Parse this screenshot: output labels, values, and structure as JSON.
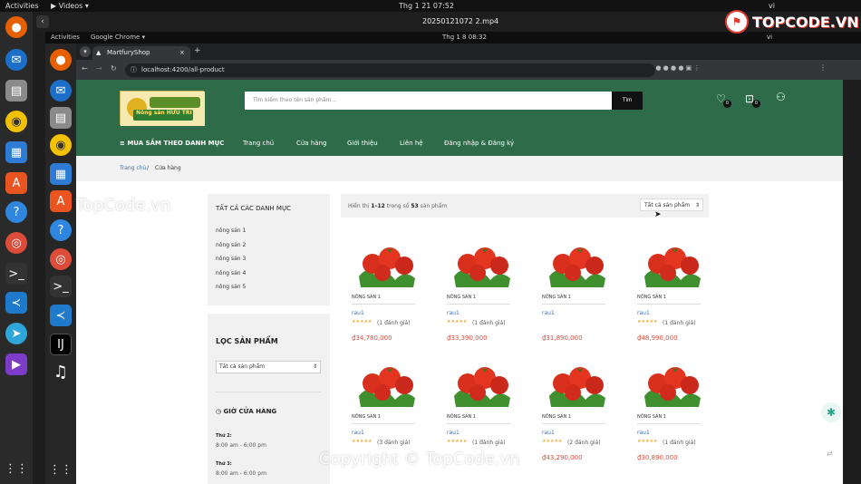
{
  "outer": {
    "activities": "Activities",
    "app_name": "Videos",
    "clock": "Thg 1 21  07:52",
    "lang": "vi",
    "window_title": "20250121072 2.mp4"
  },
  "inner": {
    "activities": "Activities",
    "app_name": "Google Chrome",
    "clock": "Thg 1 8  08:32",
    "lang": "vi"
  },
  "browser": {
    "tab_title": "MartfuryShop",
    "url": "localhost:4200/all-product"
  },
  "watermark": {
    "logo_text": "TOPCODE.VN",
    "left_text": "TopCode.vn",
    "bottom_text": "Copyright © TopCode.vn"
  },
  "shop": {
    "logo_text": "Nông sản HỮU TRÍ",
    "search_placeholder": "Tìm kiếm theo tên sản phẩm...",
    "search_button": "Tìm",
    "wishlist_count": "0",
    "cart_count": "0",
    "menu": {
      "categories": "MUA SẮM THEO DANH MỤC",
      "home": "Trang chủ",
      "store": "Cửa hàng",
      "about": "Giới thiệu",
      "contact": "Liên hệ",
      "auth": "Đăng nhập & Đăng ký"
    },
    "breadcrumb": {
      "home": "Trang chủ",
      "sep": " / ",
      "current": "Cửa hàng"
    },
    "sidebar": {
      "cat_title": "TẤT CẢ CÁC DANH MỤC",
      "categories": [
        "nông sản 1",
        "nông sản 2",
        "nông sản 3",
        "nông sản 4",
        "nông sản 5"
      ],
      "filter_title": "LỌC SẢN PHẨM",
      "filter_select": "Tất cả sản phẩm",
      "hours_title": "GIỜ CỬA HÀNG",
      "hours": [
        {
          "day": "Thứ 2:",
          "time": "8:00 am - 6:00 pm"
        },
        {
          "day": "Thứ 3:",
          "time": "8:00 am - 6:00 pm"
        }
      ]
    },
    "listing": {
      "showing_prefix": "Hiển thị ",
      "showing_range": "1–12",
      "showing_middle": " trong số ",
      "total": "53",
      "showing_suffix": " sản phẩm",
      "sort_label": "Tất cả sản phẩm"
    },
    "products": [
      {
        "category": "NÔNG SẢN 1",
        "name": "rau1",
        "rating": 5,
        "reviews": "(1 đánh giá)",
        "price": "₫34,780,000"
      },
      {
        "category": "NÔNG SẢN 1",
        "name": "rau1",
        "rating": 5,
        "reviews": "(1 đánh giá)",
        "price": "₫33,390,000"
      },
      {
        "category": "NÔNG SẢN 1",
        "name": "rau1",
        "rating": 0,
        "reviews": "",
        "price": "₫31,890,000"
      },
      {
        "category": "NÔNG SẢN 1",
        "name": "rau1",
        "rating": 5,
        "reviews": "(1 đánh giá)",
        "price": "₫48,990,000"
      },
      {
        "category": "NÔNG SẢN 1",
        "name": "rau1",
        "rating": 5,
        "reviews": "(3 đánh giá)",
        "price": ""
      },
      {
        "category": "NÔNG SẢN 1",
        "name": "rau1",
        "rating": 5,
        "reviews": "(1 đánh giá)",
        "price": ""
      },
      {
        "category": "NÔNG SẢN 1",
        "name": "rau1",
        "rating": 5,
        "reviews": "(2 đánh giá)",
        "price": "₫43,290,000"
      },
      {
        "category": "NÔNG SẢN 1",
        "name": "rau1",
        "rating": 5,
        "reviews": "(1 đánh giá)",
        "price": "₫30,890,000"
      }
    ]
  }
}
